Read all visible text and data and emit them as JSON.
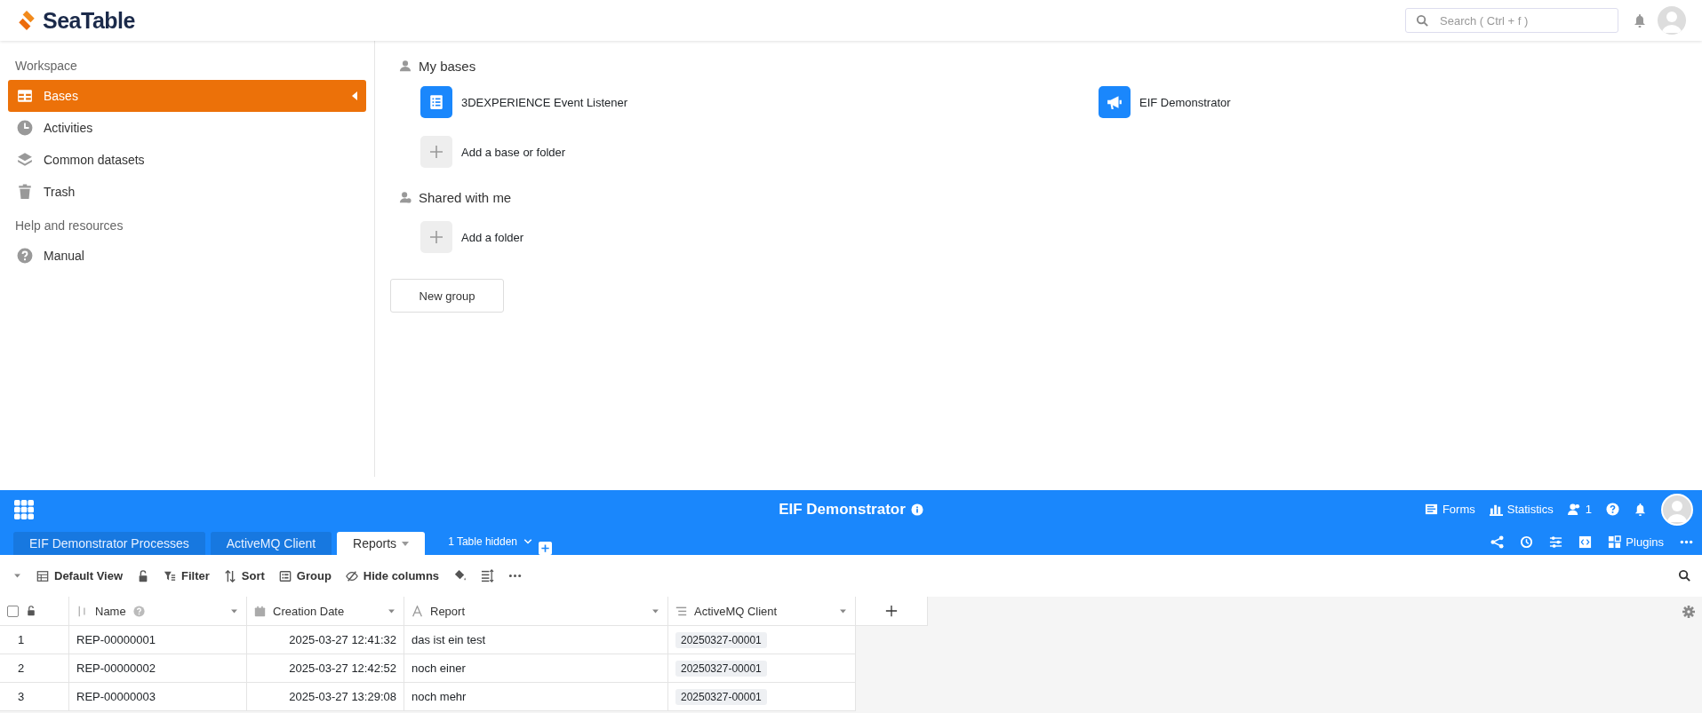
{
  "app_header": {
    "logo_text": "SeaTable",
    "search": {
      "placeholder": "Search ( Ctrl + f )"
    }
  },
  "sidebar": {
    "sections": [
      {
        "title": "Workspace",
        "items": [
          {
            "label": "Bases",
            "kind": "table",
            "selected": true
          },
          {
            "label": "Activities",
            "kind": "clock",
            "selected": false
          },
          {
            "label": "Common datasets",
            "kind": "layers",
            "selected": false
          },
          {
            "label": "Trash",
            "kind": "trash",
            "selected": false
          }
        ]
      },
      {
        "title": "Help and resources",
        "items": [
          {
            "label": "Manual",
            "kind": "help",
            "selected": false
          }
        ]
      }
    ]
  },
  "main": {
    "groups": [
      {
        "title": "My bases",
        "kind": "user",
        "bases": [
          {
            "name": "3DEXPERIENCE Event Listener",
            "kind": "list"
          },
          {
            "name": "EIF Demonstrator",
            "kind": "megaphone"
          }
        ],
        "add_label": "Add a base or folder"
      },
      {
        "title": "Shared with me",
        "kind": "users",
        "add_label": "Add a folder"
      }
    ],
    "new_group_button": "New group"
  },
  "base_view": {
    "title": "EIF Demonstrator",
    "header_actions": [
      {
        "label": "Forms",
        "kind": "forms"
      },
      {
        "label": "Statistics",
        "kind": "stats"
      },
      {
        "label": "1",
        "kind": "collaborators"
      }
    ],
    "tabs": [
      {
        "label": "EIF Demonstrator Processes",
        "selected": false
      },
      {
        "label": "ActiveMQ Client",
        "selected": false
      },
      {
        "label": "Reports",
        "selected": true
      }
    ],
    "hidden_tables": "1 Table hidden",
    "plugins_label": "Plugins",
    "toolbar": {
      "view": "Default View",
      "items": [
        {
          "label": "Filter",
          "kind": "filter"
        },
        {
          "label": "Sort",
          "kind": "sort"
        },
        {
          "label": "Group",
          "kind": "group"
        },
        {
          "label": "Hide columns",
          "kind": "hide"
        }
      ]
    },
    "table": {
      "select_all_checked": false,
      "columns": [
        {
          "name": "Name",
          "kind": "name"
        },
        {
          "name": "Creation Date",
          "kind": "date"
        },
        {
          "name": "Report",
          "kind": "text"
        },
        {
          "name": "ActiveMQ Client",
          "kind": "link"
        }
      ],
      "rows": [
        {
          "index": "1",
          "name": "REP-00000001",
          "date": "2025-03-27 12:41:32",
          "report": "das ist ein test",
          "client": "20250327-00001"
        },
        {
          "index": "2",
          "name": "REP-00000002",
          "date": "2025-03-27 12:42:52",
          "report": "noch einer",
          "client": "20250327-00001"
        },
        {
          "index": "3",
          "name": "REP-00000003",
          "date": "2025-03-27 13:29:08",
          "report": "noch mehr",
          "client": "20250327-00001"
        }
      ]
    }
  }
}
